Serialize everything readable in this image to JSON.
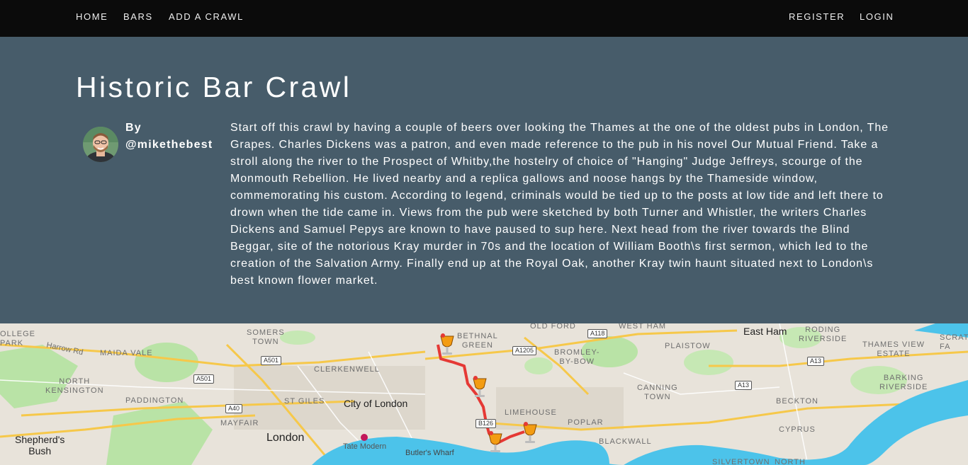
{
  "nav": {
    "left": [
      "HOME",
      "BARS",
      "ADD A CRAWL"
    ],
    "right": [
      "REGISTER",
      "LOGIN"
    ]
  },
  "crawl": {
    "title": "Historic Bar Crawl",
    "by_label": "By",
    "author": "@mikethebest",
    "description": "Start off this crawl by having a couple of beers over looking the Thames at the one of the oldest pubs in London, The Grapes. Charles Dickens was a patron, and even made reference to the pub in his novel Our Mutual Friend. Take a stroll along the river to the Prospect of Whitby,the hostelry of choice of \"Hanging\" Judge Jeffreys, scourge of the Monmouth Rebellion. He lived nearby and a replica gallows and noose hangs by the Thameside window, commemorating his custom. According to legend, criminals would be tied up to the posts at low tide and left there to drown when the tide came in. Views from the pub were sketched by both Turner and Whistler, the writers Charles Dickens and Samuel Pepys are known to have paused to sup here. Next head from the river towards the Blind Beggar, site of the notorious Kray murder in 70s and the location of William Booth\\s first sermon, which led to the creation of the Salvation Army. Finally end up at the Royal Oak, another Kray twin haunt situated next to London\\s best known flower market."
  },
  "map": {
    "place_labels": {
      "college_park": "OLLEGE\nPARK",
      "maida_vale": "MAIDA VALE",
      "harrow_rd": "Harrow Rd",
      "north_kensington": "NORTH\nKENSINGTON",
      "paddington": "PADDINGTON",
      "somers_town": "SOMERS\nTOWN",
      "clerkenwell": "CLERKENWELL",
      "st_giles": "ST GILES",
      "mayfair": "MAYFAIR",
      "city_of_london": "City of London",
      "london": "London",
      "shepherds_bush": "Shepherd's\nBush",
      "tate_modern": "Tate Modern",
      "butlers_wharf": "Butler's Wharf",
      "bethnal_green": "BETHNAL\nGREEN",
      "old_ford": "OLD FORD",
      "west_ham": "WEST HAM",
      "bromley_by_bow": "BROMLEY-\nBY-BOW",
      "plaistow": "PLAISTOW",
      "east_ham": "East Ham",
      "roding_riverside": "RODING\nRIVERSIDE",
      "thames_view_estate": "THAMES VIEW\nESTATE",
      "scratch": "SCRAT\nFA",
      "canning_town": "CANNING\nTOWN",
      "limehouse": "LIMEHOUSE",
      "poplar": "POPLAR",
      "blackwall": "BLACKWALL",
      "beckton": "BECKTON",
      "barking_riverside": "BARKING\nRIVERSIDE",
      "cyprus": "CYPRUS",
      "silvertown": "SILVERTOWN",
      "north": "NORTH"
    },
    "road_badges": [
      "A501",
      "A501",
      "A40",
      "A1205",
      "A118",
      "A13",
      "A13",
      "B126"
    ],
    "route_color": "#e53935",
    "water_color": "#4cc3ea",
    "park_color": "#b9e3a6",
    "pins": [
      "pin-1",
      "pin-2",
      "pin-3",
      "pin-4"
    ]
  },
  "colors": {
    "navbar_bg": "#0b0b0b",
    "hero_bg": "#475c6a",
    "hero_text": "#ffffff"
  }
}
